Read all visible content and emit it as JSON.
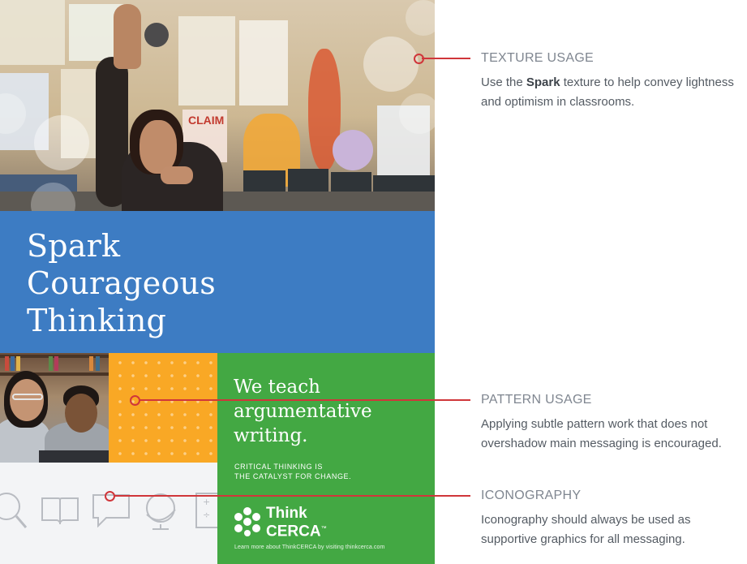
{
  "poster": {
    "headline": [
      "Spark",
      "Courageous",
      "Thinking"
    ],
    "teach": [
      "We teach",
      "argumentative",
      "writing."
    ],
    "tagline": [
      "CRITICAL THINKING IS",
      "THE CATALYST FOR CHANGE."
    ],
    "logo": [
      "Think",
      "CERCA"
    ],
    "logo_tm": "™",
    "learn_more": "Learn more about ThinkCERCA by visiting thinkcerca.com",
    "classroom_signs": [
      "CLAIM"
    ],
    "colors": {
      "blue": "#3d7cc3",
      "orange": "#f9a825",
      "green": "#43a843",
      "callout": "#d0363a"
    },
    "icons": [
      "magnifier-icon",
      "book-icon",
      "speech-bubble-icon",
      "globe-icon",
      "calculator-icon"
    ]
  },
  "annotations": {
    "texture": {
      "title": "TEXTURE USAGE",
      "text_before": "Use the ",
      "text_bold": "Spark",
      "text_after": " texture to help convey lightness and optimism in classrooms."
    },
    "pattern": {
      "title": "PATTERN USAGE",
      "text": "Applying subtle pattern work that does not overshadow main messaging is encouraged."
    },
    "iconography": {
      "title": "ICONOGRAPHY",
      "text": "Iconography should always be used as supportive graphics for all messaging."
    }
  }
}
